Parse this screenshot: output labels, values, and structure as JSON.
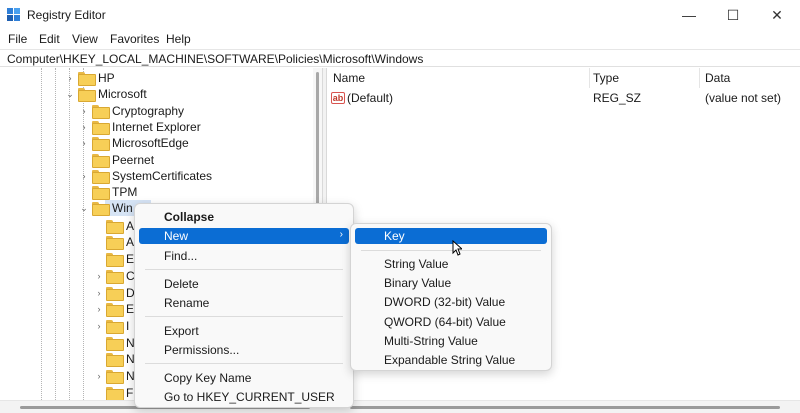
{
  "window": {
    "title": "Registry Editor",
    "controls": {
      "minimize": "—",
      "maximize": "☐",
      "close": "✕"
    }
  },
  "menu": [
    "File",
    "Edit",
    "View",
    "Favorites",
    "Help"
  ],
  "address": "Computer\\HKEY_LOCAL_MACHINE\\SOFTWARE\\Policies\\Microsoft\\Windows",
  "tree": {
    "rows": [
      {
        "label": "HP",
        "chevron": "›"
      },
      {
        "label": "Microsoft",
        "chevron": "⌄"
      },
      {
        "label": "Cryptography",
        "chevron": "›"
      },
      {
        "label": "Internet Explorer",
        "chevron": "›"
      },
      {
        "label": "MicrosoftEdge",
        "chevron": "›"
      },
      {
        "label": "Peernet",
        "chevron": ""
      },
      {
        "label": "SystemCertificates",
        "chevron": "›"
      },
      {
        "label": "TPM",
        "chevron": ""
      },
      {
        "label": "Win",
        "chevron": "⌄"
      }
    ],
    "child_fragments": [
      "A",
      "A",
      "E",
      "C",
      "D",
      "E",
      "I",
      "N",
      "N",
      "N",
      "F"
    ],
    "child_chevrons": [
      "",
      "",
      "",
      "›",
      "›",
      "›",
      "›",
      "",
      "",
      "›",
      ""
    ]
  },
  "list": {
    "columns": [
      "Name",
      "Type",
      "Data"
    ],
    "rows": [
      {
        "icon": "ab",
        "name": "(Default)",
        "type": "REG_SZ",
        "data": "(value not set)"
      }
    ]
  },
  "context_menu": {
    "items": [
      "Collapse",
      "New",
      "Find...",
      "Delete",
      "Rename",
      "Export",
      "Permissions...",
      "Copy Key Name",
      "Go to HKEY_CURRENT_USER"
    ],
    "highlighted": "New",
    "submenu_arrow": "›"
  },
  "submenu": {
    "items": [
      "Key",
      "String Value",
      "Binary Value",
      "DWORD (32-bit) Value",
      "QWORD (64-bit) Value",
      "Multi-String Value",
      "Expandable String Value"
    ],
    "highlighted": "Key"
  },
  "colors": {
    "highlight": "#0b6dd4",
    "folder": "#f7cf57",
    "selection": "#d6e4f5"
  }
}
